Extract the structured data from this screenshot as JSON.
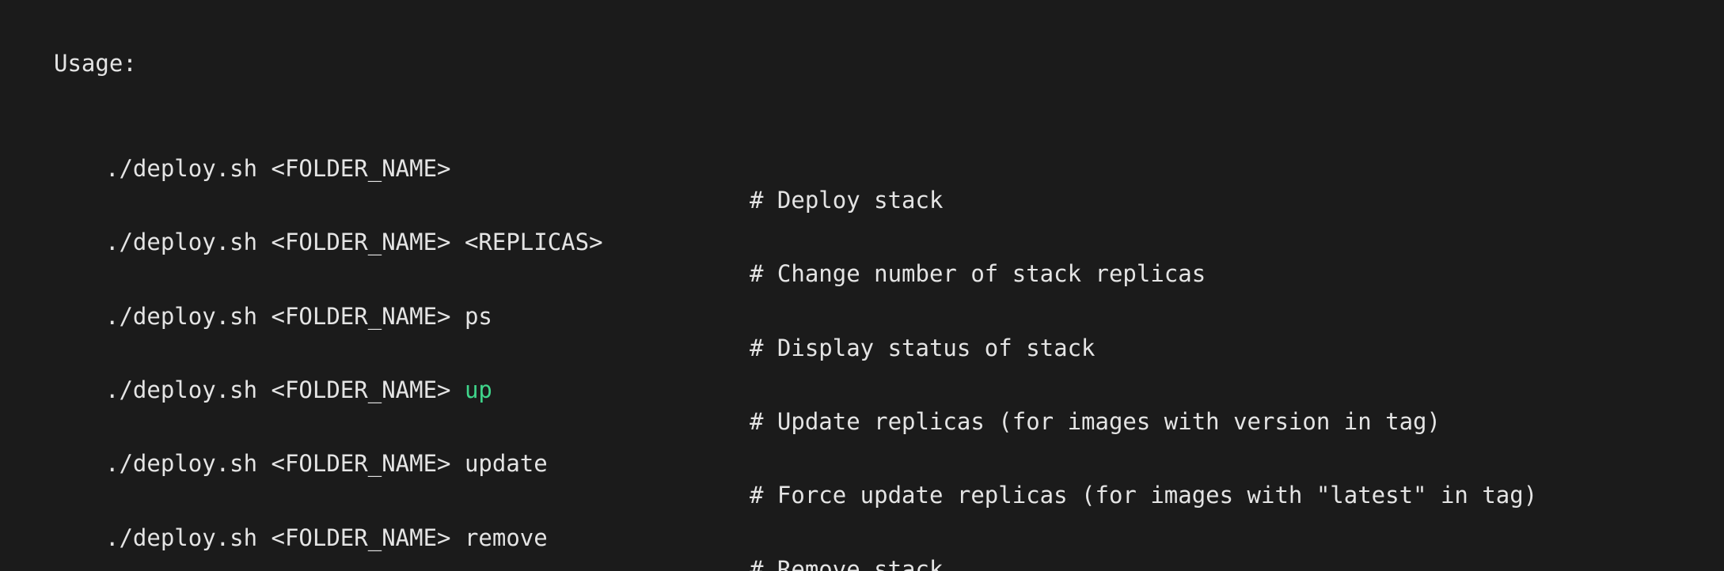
{
  "top_clipped_text": "             ",
  "usage_label": "Usage:",
  "rows": [
    {
      "command": "./deploy.sh <FOLDER_NAME>",
      "arg": "",
      "arg_color": "#e4e4e4",
      "comment": "# Deploy stack"
    },
    {
      "command": "./deploy.sh <FOLDER_NAME> ",
      "arg": "<REPLICAS>",
      "arg_color": "#e4e4e4",
      "comment": "# Change number of stack replicas"
    },
    {
      "command": "./deploy.sh <FOLDER_NAME> ",
      "arg": "ps",
      "arg_color": "#e4e4e4",
      "comment": "# Display status of stack"
    },
    {
      "command": "./deploy.sh <FOLDER_NAME> ",
      "arg": "up",
      "arg_color": "#3fd48a",
      "comment": "# Update replicas (for images with version in tag)"
    },
    {
      "command": "./deploy.sh <FOLDER_NAME> ",
      "arg": "update",
      "arg_color": "#e4e4e4",
      "comment": "# Force update replicas (for images with \"latest\" in tag)"
    },
    {
      "command": "./deploy.sh <FOLDER_NAME> ",
      "arg": "remove",
      "arg_color": "#e4e4e4",
      "comment": "# Remove stack"
    }
  ],
  "colors": {
    "background": "#1b1b1b",
    "text": "#e4e4e4",
    "highlight": "#3fd48a"
  }
}
